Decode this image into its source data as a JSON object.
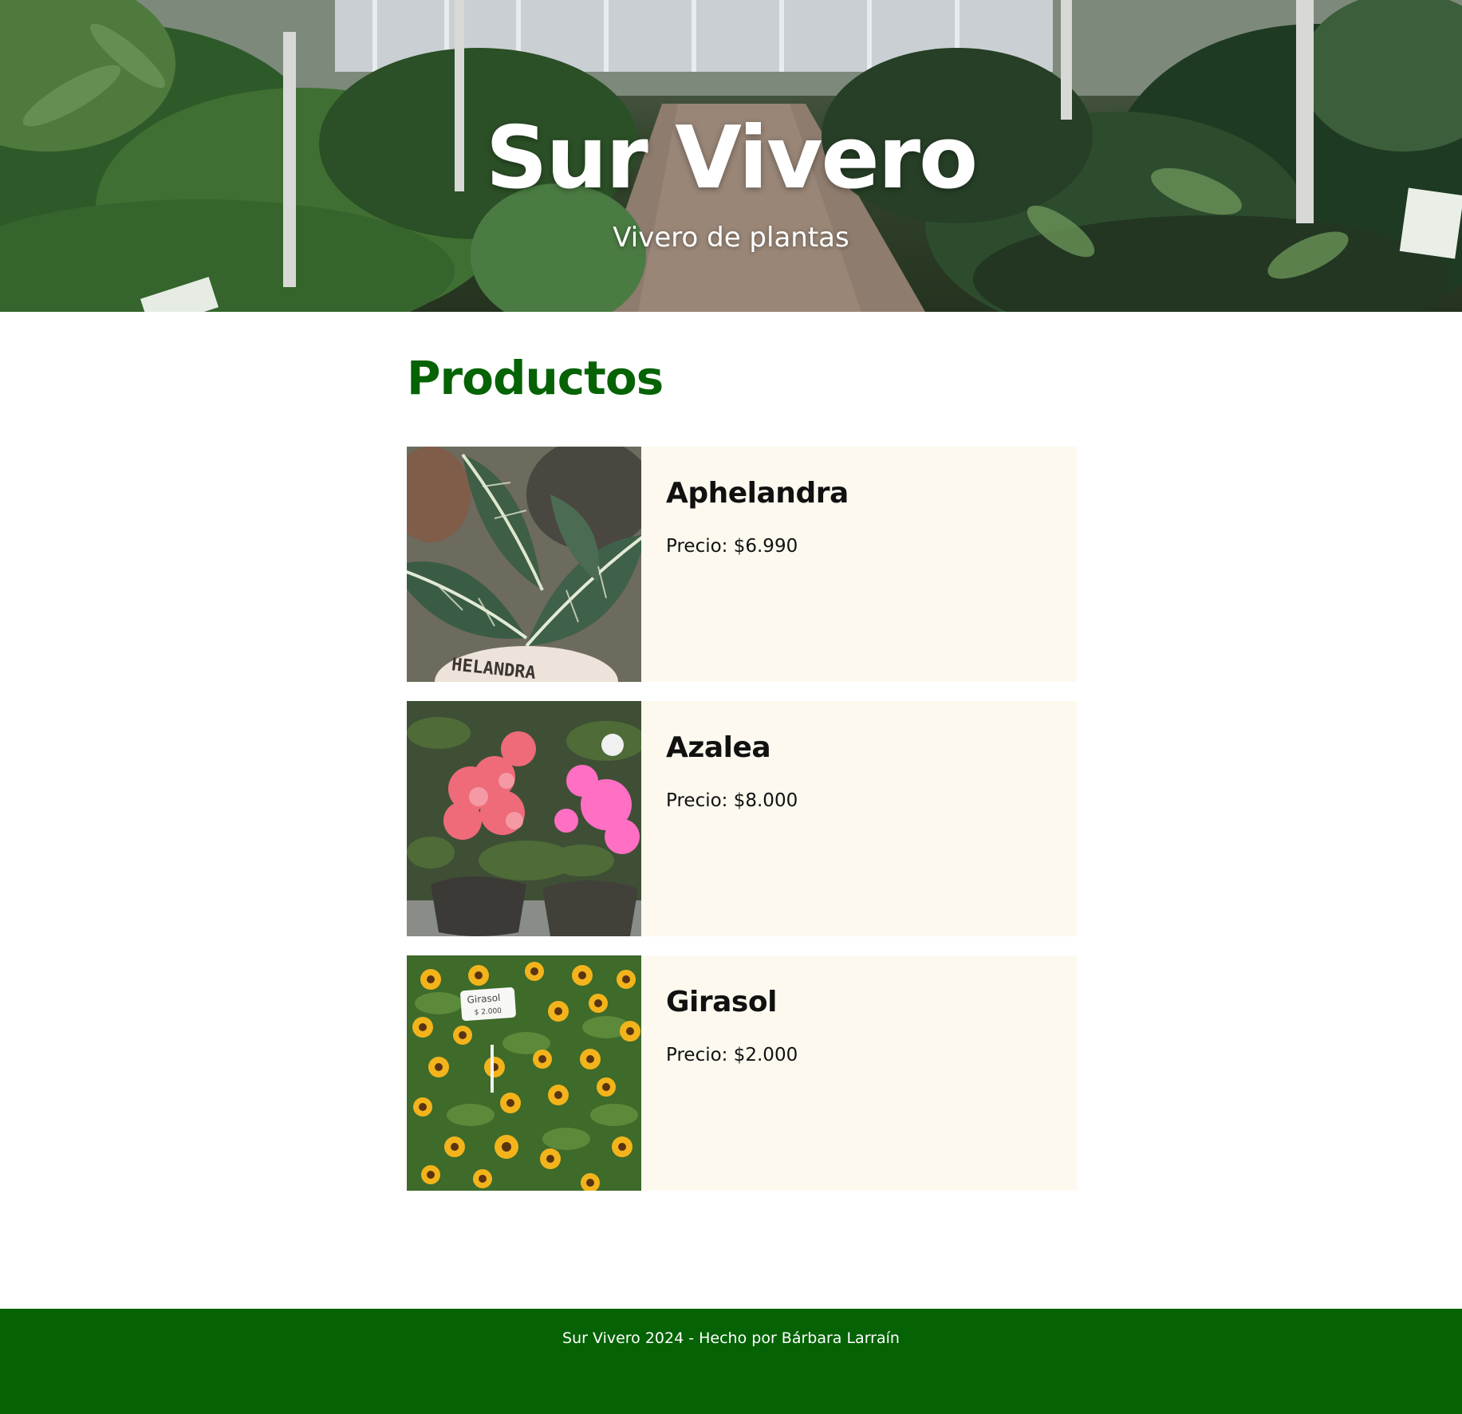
{
  "hero": {
    "title": "Sur Vivero",
    "subtitle": "Vivero de plantas"
  },
  "products_section": {
    "title": "Productos",
    "items": [
      {
        "name": "Aphelandra",
        "price": "Precio: $6.990",
        "photo_label": "HELANDRA"
      },
      {
        "name": "Azalea",
        "price": "Precio: $8.000"
      },
      {
        "name": "Girasol",
        "price": "Precio: $2.000",
        "photo_label": "Girasol",
        "photo_price": "$ 2.000"
      }
    ]
  },
  "footer": {
    "text": "Sur Vivero 2024 - Hecho por Bárbara Larraín"
  },
  "colors": {
    "accent_green": "#056305",
    "card_background": "#fdf9ef",
    "hero_text": "#ffffff"
  }
}
